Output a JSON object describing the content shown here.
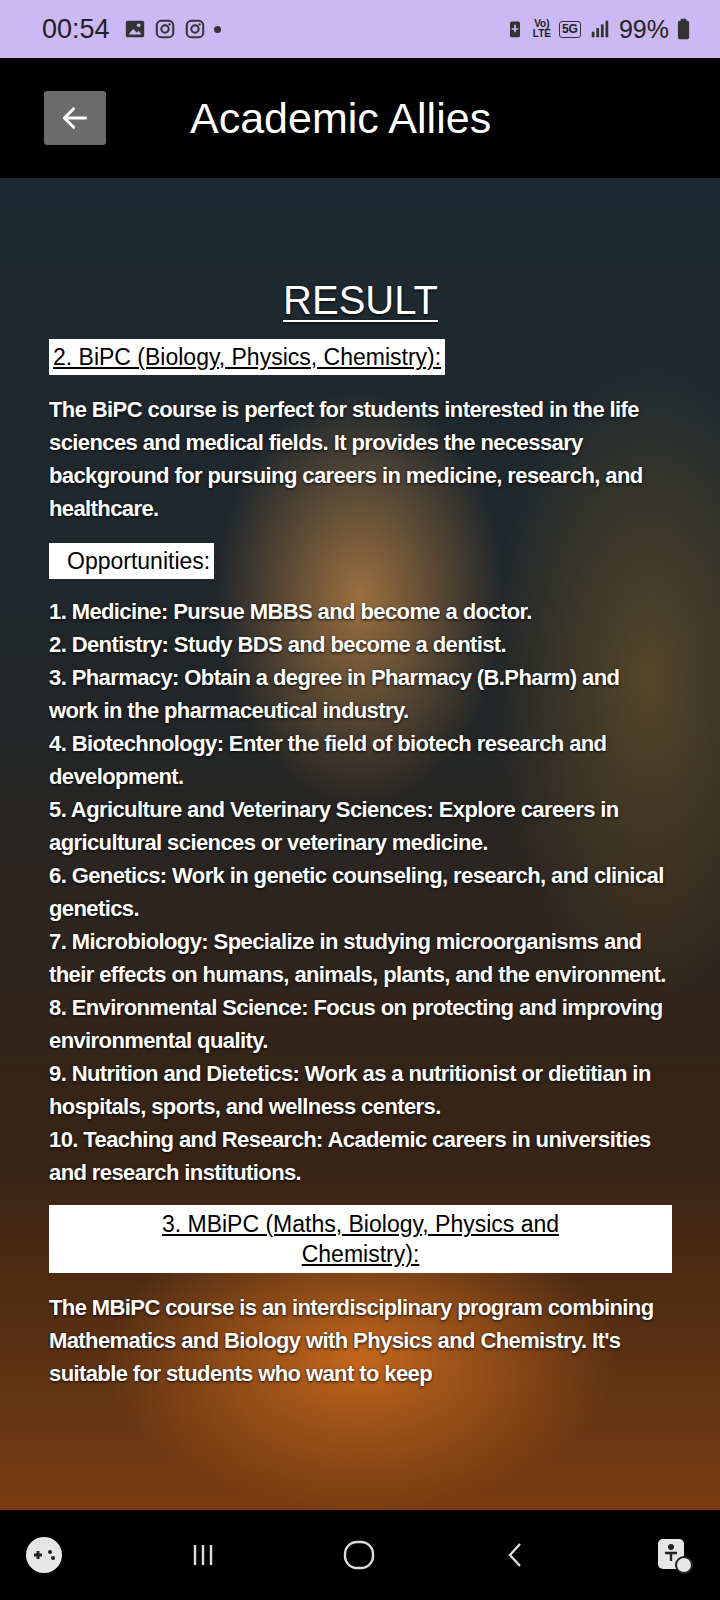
{
  "status_bar": {
    "time": "00:54",
    "volte_top": "Vo)",
    "volte_bottom": "LTE",
    "network": "5G",
    "battery": "99%"
  },
  "app_bar": {
    "title": "Academic Allies"
  },
  "page": {
    "title": "RESULT"
  },
  "sections": [
    {
      "kind": "inline",
      "heading": "2. BiPC (Biology, Physics, Chemistry):",
      "description": "The BiPC course is perfect for students interested in the life sciences and medical fields. It provides the necessary background for pursuing careers in medicine, research, and healthcare.",
      "opportunities_label": "Opportunities:",
      "opportunities": [
        "1. Medicine: Pursue MBBS and become a doctor.",
        "2. Dentistry: Study BDS and become a dentist.",
        "3. Pharmacy: Obtain a degree in Pharmacy (B.Pharm) and work in the pharmaceutical industry.",
        "4. Biotechnology: Enter the field of biotech research and development.",
        "5. Agriculture and Veterinary Sciences: Explore careers in agricultural sciences or veterinary medicine.",
        "6. Genetics: Work in genetic counseling, research, and clinical genetics.",
        "7. Microbiology: Specialize in studying microorganisms and their effects on humans, animals, plants, and the environment.",
        "8. Environmental Science: Focus on protecting and improving environmental quality.",
        "9. Nutrition and Dietetics: Work as a nutritionist or dietitian in hospitals, sports, and wellness centers.",
        "10. Teaching and Research: Academic careers in universities and research institutions."
      ]
    },
    {
      "kind": "banner",
      "heading": "3. MBiPC (Maths, Biology, Physics and Chemistry):",
      "description": "The MBiPC course is an interdisciplinary program combining Mathematics and Biology with Physics and Chemistry. It's suitable for students who want to keep",
      "opportunities_label": "",
      "opportunities": []
    }
  ]
}
